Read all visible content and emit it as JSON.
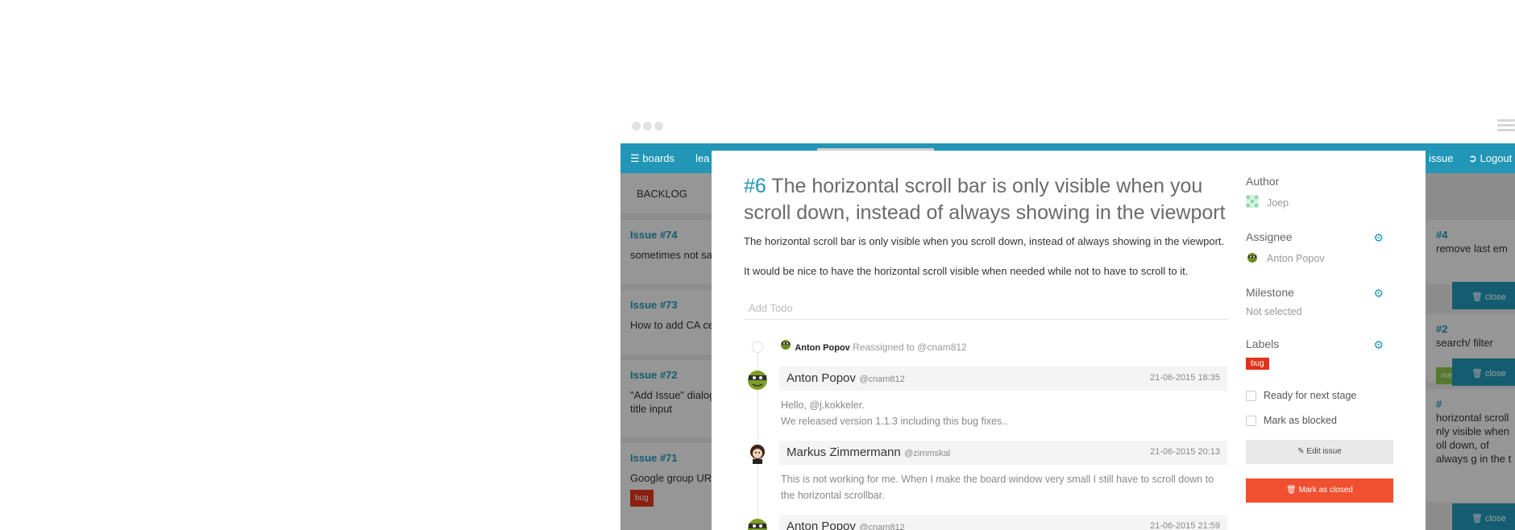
{
  "navbar": {
    "boards_label": "boards",
    "learn_label": "lea",
    "issue_label": "issue",
    "logout_label": "Logout"
  },
  "board": {
    "column_title": "BACKLOG",
    "cards": [
      {
        "title": "Issue #74",
        "text": "sometimes not sa things"
      },
      {
        "title": "Issue #73",
        "text": "How to add CA ce docker?"
      },
      {
        "title": "Issue #72",
        "text": "\"Add Issue\" dialog should set focus o title input"
      },
      {
        "title": "Issue #71",
        "text": "Google group URL not correctly linke",
        "tag": "bug"
      }
    ],
    "right_cards": [
      {
        "title": "#4",
        "text": "remove last em"
      },
      {
        "title": "#2",
        "text": "search/ filter"
      },
      {
        "title": "#",
        "text": "horizontal scroll nly visible when oll down, of always g in the t"
      }
    ],
    "right_close_label": "close",
    "right_tag": "ment"
  },
  "issue": {
    "number": "#6",
    "title": " The horizontal scroll bar is only visible when you scroll down, instead of always showing in the viewport",
    "description_1": "The horizontal scroll bar is only visible when you scroll down, instead of always showing in the viewport.",
    "description_2": "It would be nice to have the horizontal scroll visible when needed while not to have to scroll to it.",
    "todo_placeholder": "Add Todo",
    "event": {
      "who": "Anton Popov",
      "action": "Reassigned to @cnam812"
    },
    "comments": [
      {
        "name": "Anton Popov",
        "handle": "@cnam812",
        "date": "21-06-2015 18:35",
        "lines": [
          "Hello, @j.kokkeler.",
          "We released version 1.1.3 including this bug fixes.."
        ]
      },
      {
        "name": "Markus Zimmermann",
        "handle": "@zimmskal",
        "date": "21-06-2015 20:13",
        "lines": [
          "This is not working for me. When I make the board window very small I still have to scroll down to",
          "the horizontal scrollbar."
        ]
      },
      {
        "name": "Anton Popov",
        "handle": "@cnam812",
        "date": "21-06-2015 21:59",
        "lines": []
      }
    ]
  },
  "sidebar": {
    "author_label": "Author",
    "author_value": "Joep",
    "assignee_label": "Assignee",
    "assignee_value": "Anton Popov",
    "milestone_label": "Milestone",
    "milestone_value": "Not selected",
    "labels_label": "Labels",
    "label_bug": "bug",
    "ready_label": "Ready for next stage",
    "blocked_label": "Mark as blocked",
    "edit_label": "Edit issue",
    "close_label": "Mark as closed"
  },
  "colors": {
    "accent": "#2196b6",
    "danger": "#f0502f",
    "bug": "#e0321b"
  }
}
